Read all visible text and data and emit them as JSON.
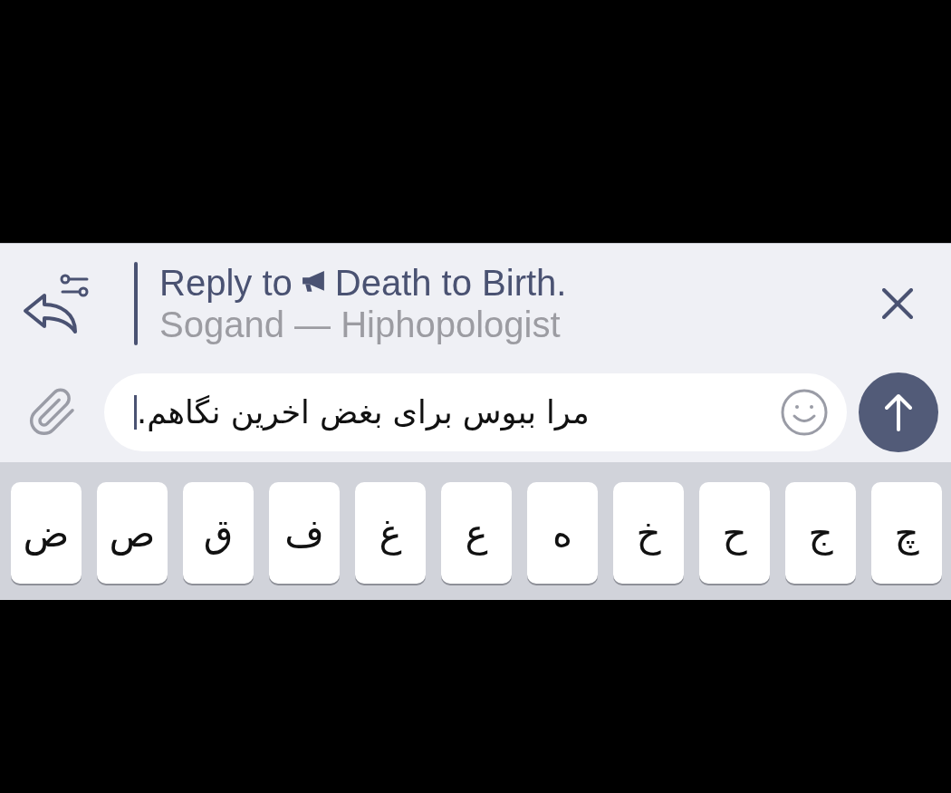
{
  "reply_preview": {
    "label": "Reply to",
    "title": "Death to Birth.",
    "subtitle": "Sogand — Hiphopologist"
  },
  "composer": {
    "value": "مرا ببوس برای بغض اخرین نگاهم.",
    "focused": true
  },
  "keyboard": {
    "keys": [
      "چ",
      "ج",
      "ح",
      "خ",
      "ه",
      "ع",
      "غ",
      "ف",
      "ق",
      "ص",
      "ض"
    ]
  }
}
